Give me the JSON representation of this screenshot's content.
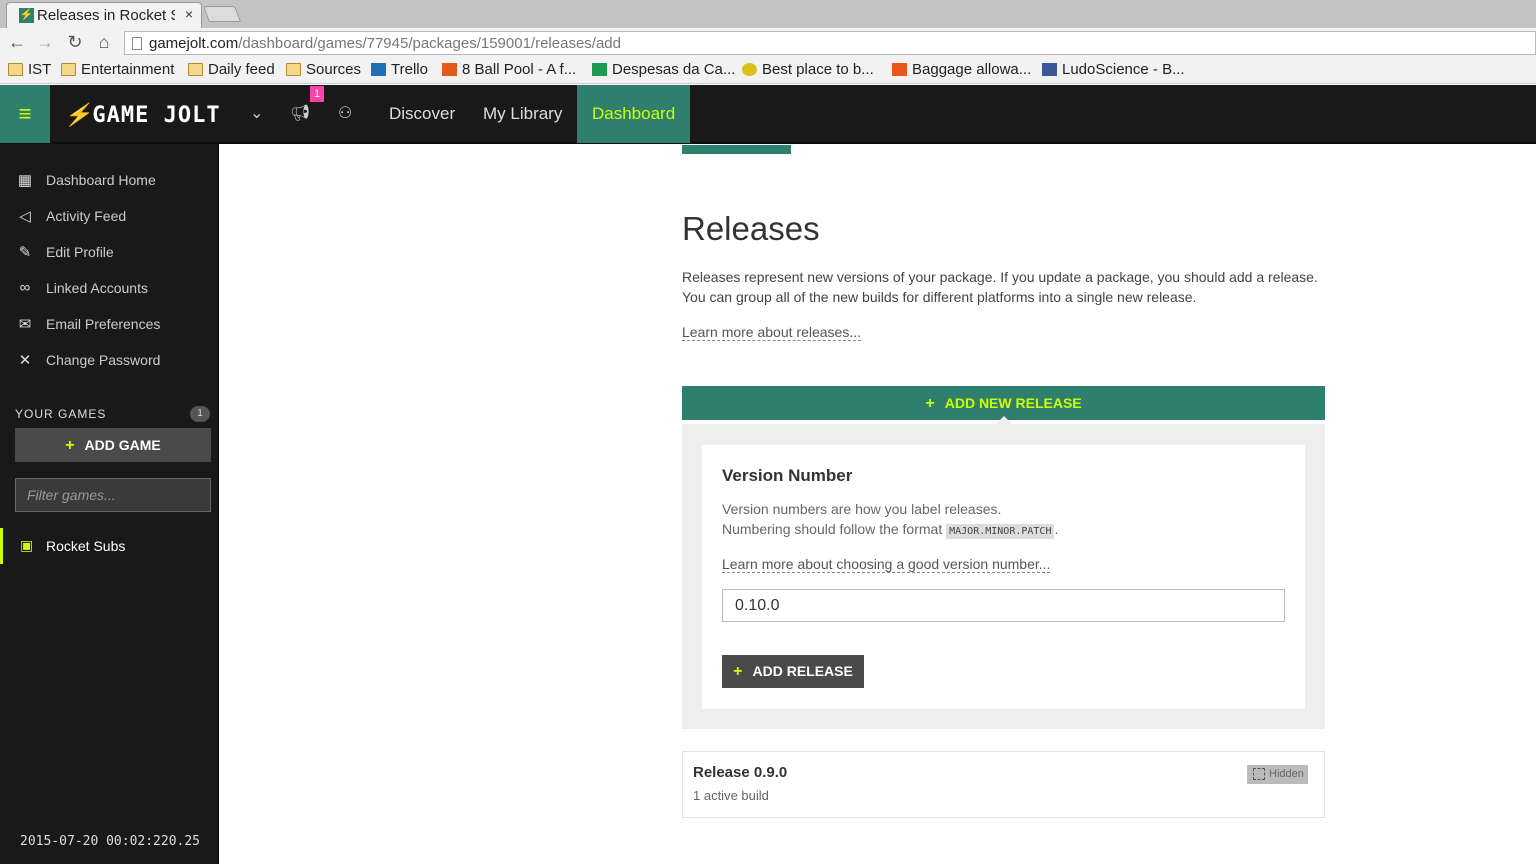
{
  "browser": {
    "tab_title": "Releases in Rocket Su",
    "tab_close": "×",
    "url_host": "gamejolt.com",
    "url_path": "/dashboard/games/77945/packages/159001/releases/add",
    "nav": {
      "back": "←",
      "forward": "→",
      "reload": "↻",
      "home": "⌂"
    },
    "bookmarks": [
      "IST",
      "Entertainment",
      "Daily feed",
      "Sources",
      "Trello",
      "8 Ball Pool - A f...",
      "Despesas da Ca...",
      "Best place to b...",
      "Baggage allowa...",
      "LudoScience - B..."
    ]
  },
  "topbar": {
    "logo": "GAME JOLT",
    "notification_count": "1",
    "nav": [
      "Discover",
      "My Library",
      "Dashboard"
    ],
    "active_nav": "Dashboard",
    "accent_color": "#2f7f6e",
    "highlight_color": "#ccff00"
  },
  "sidebar": {
    "items": [
      {
        "label": "Dashboard Home",
        "icon": "dashboard-icon"
      },
      {
        "label": "Activity Feed",
        "icon": "megaphone-icon"
      },
      {
        "label": "Edit Profile",
        "icon": "pencil-icon"
      },
      {
        "label": "Linked Accounts",
        "icon": "link-icon"
      },
      {
        "label": "Email Preferences",
        "icon": "envelope-icon"
      },
      {
        "label": "Change Password",
        "icon": "tools-icon"
      }
    ],
    "your_games_label": "YOUR GAMES",
    "games_count": "1",
    "add_game_label": "ADD GAME",
    "filter_placeholder": "Filter games...",
    "games": [
      "Rocket Subs"
    ],
    "timestamp": "2015-07-20 00:02:220.25"
  },
  "main": {
    "title": "Releases",
    "description_line1": "Releases represent new versions of your package. If you update a package, you should add a release.",
    "description_line2": "You can group all of the new builds for different platforms into a single new release.",
    "learn_more": "Learn more about releases...",
    "add_new_release": "ADD NEW RELEASE",
    "form": {
      "title": "Version Number",
      "help_line1": "Version numbers are how you label releases.",
      "help_line2_prefix": "Numbering should follow the format ",
      "help_code": "MAJOR.MINOR.PATCH",
      "help_line2_suffix": ".",
      "learn_more": "Learn more about choosing a good version number...",
      "version_value": "0.10.0",
      "submit_label": "ADD RELEASE"
    },
    "releases": [
      {
        "title": "Release 0.9.0",
        "subtitle": "1 active build",
        "badge": "Hidden"
      }
    ]
  }
}
